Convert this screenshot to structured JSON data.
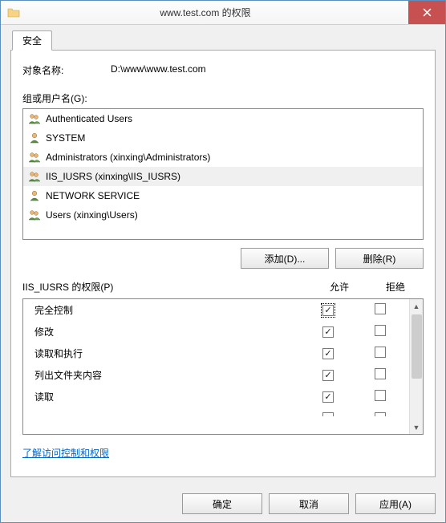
{
  "title": "www.test.com 的权限",
  "tab_label": "安全",
  "object": {
    "label": "对象名称:",
    "value": "D:\\www\\www.test.com"
  },
  "groups": {
    "label": "组或用户名(G):",
    "items": [
      {
        "name": "Authenticated Users",
        "selected": false,
        "icon": "users"
      },
      {
        "name": "SYSTEM",
        "selected": false,
        "icon": "user"
      },
      {
        "name": "Administrators (xinxing\\Administrators)",
        "selected": false,
        "icon": "users"
      },
      {
        "name": "IIS_IUSRS (xinxing\\IIS_IUSRS)",
        "selected": true,
        "icon": "users"
      },
      {
        "name": "NETWORK SERVICE",
        "selected": false,
        "icon": "user"
      },
      {
        "name": "Users (xinxing\\Users)",
        "selected": false,
        "icon": "users"
      }
    ]
  },
  "buttons": {
    "add": "添加(D)...",
    "remove": "删除(R)"
  },
  "permissions": {
    "title": "IIS_IUSRS 的权限(P)",
    "col_allow": "允许",
    "col_deny": "拒绝",
    "rows": [
      {
        "name": "完全控制",
        "allow": true,
        "deny": false,
        "focus": true
      },
      {
        "name": "修改",
        "allow": true,
        "deny": false
      },
      {
        "name": "读取和执行",
        "allow": true,
        "deny": false
      },
      {
        "name": "列出文件夹内容",
        "allow": true,
        "deny": false
      },
      {
        "name": "读取",
        "allow": true,
        "deny": false
      }
    ]
  },
  "link": "了解访问控制和权限",
  "footer": {
    "ok": "确定",
    "cancel": "取消",
    "apply": "应用(A)"
  }
}
